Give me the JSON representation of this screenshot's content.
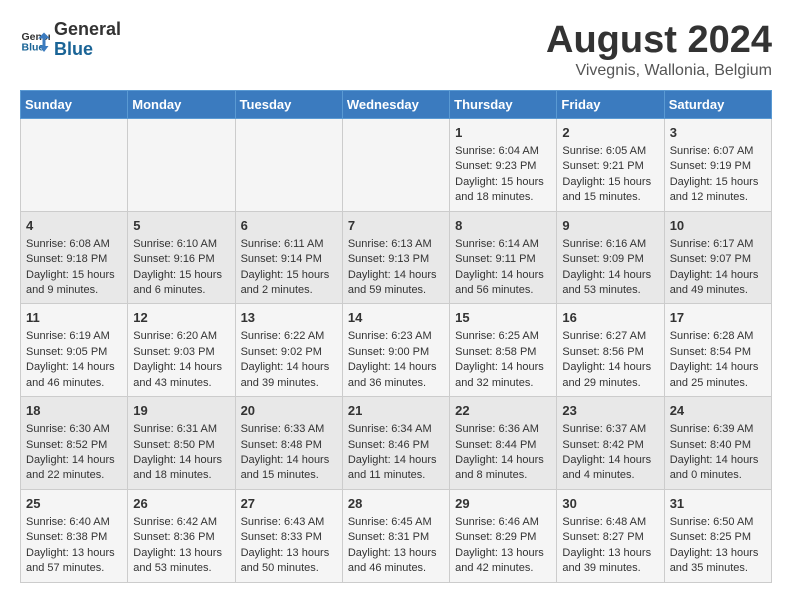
{
  "header": {
    "logo_line1": "General",
    "logo_line2": "Blue",
    "month": "August 2024",
    "location": "Vivegnis, Wallonia, Belgium"
  },
  "days_of_week": [
    "Sunday",
    "Monday",
    "Tuesday",
    "Wednesday",
    "Thursday",
    "Friday",
    "Saturday"
  ],
  "weeks": [
    [
      {
        "day": "",
        "content": ""
      },
      {
        "day": "",
        "content": ""
      },
      {
        "day": "",
        "content": ""
      },
      {
        "day": "",
        "content": ""
      },
      {
        "day": "1",
        "content": "Sunrise: 6:04 AM\nSunset: 9:23 PM\nDaylight: 15 hours\nand 18 minutes."
      },
      {
        "day": "2",
        "content": "Sunrise: 6:05 AM\nSunset: 9:21 PM\nDaylight: 15 hours\nand 15 minutes."
      },
      {
        "day": "3",
        "content": "Sunrise: 6:07 AM\nSunset: 9:19 PM\nDaylight: 15 hours\nand 12 minutes."
      }
    ],
    [
      {
        "day": "4",
        "content": "Sunrise: 6:08 AM\nSunset: 9:18 PM\nDaylight: 15 hours\nand 9 minutes."
      },
      {
        "day": "5",
        "content": "Sunrise: 6:10 AM\nSunset: 9:16 PM\nDaylight: 15 hours\nand 6 minutes."
      },
      {
        "day": "6",
        "content": "Sunrise: 6:11 AM\nSunset: 9:14 PM\nDaylight: 15 hours\nand 2 minutes."
      },
      {
        "day": "7",
        "content": "Sunrise: 6:13 AM\nSunset: 9:13 PM\nDaylight: 14 hours\nand 59 minutes."
      },
      {
        "day": "8",
        "content": "Sunrise: 6:14 AM\nSunset: 9:11 PM\nDaylight: 14 hours\nand 56 minutes."
      },
      {
        "day": "9",
        "content": "Sunrise: 6:16 AM\nSunset: 9:09 PM\nDaylight: 14 hours\nand 53 minutes."
      },
      {
        "day": "10",
        "content": "Sunrise: 6:17 AM\nSunset: 9:07 PM\nDaylight: 14 hours\nand 49 minutes."
      }
    ],
    [
      {
        "day": "11",
        "content": "Sunrise: 6:19 AM\nSunset: 9:05 PM\nDaylight: 14 hours\nand 46 minutes."
      },
      {
        "day": "12",
        "content": "Sunrise: 6:20 AM\nSunset: 9:03 PM\nDaylight: 14 hours\nand 43 minutes."
      },
      {
        "day": "13",
        "content": "Sunrise: 6:22 AM\nSunset: 9:02 PM\nDaylight: 14 hours\nand 39 minutes."
      },
      {
        "day": "14",
        "content": "Sunrise: 6:23 AM\nSunset: 9:00 PM\nDaylight: 14 hours\nand 36 minutes."
      },
      {
        "day": "15",
        "content": "Sunrise: 6:25 AM\nSunset: 8:58 PM\nDaylight: 14 hours\nand 32 minutes."
      },
      {
        "day": "16",
        "content": "Sunrise: 6:27 AM\nSunset: 8:56 PM\nDaylight: 14 hours\nand 29 minutes."
      },
      {
        "day": "17",
        "content": "Sunrise: 6:28 AM\nSunset: 8:54 PM\nDaylight: 14 hours\nand 25 minutes."
      }
    ],
    [
      {
        "day": "18",
        "content": "Sunrise: 6:30 AM\nSunset: 8:52 PM\nDaylight: 14 hours\nand 22 minutes."
      },
      {
        "day": "19",
        "content": "Sunrise: 6:31 AM\nSunset: 8:50 PM\nDaylight: 14 hours\nand 18 minutes."
      },
      {
        "day": "20",
        "content": "Sunrise: 6:33 AM\nSunset: 8:48 PM\nDaylight: 14 hours\nand 15 minutes."
      },
      {
        "day": "21",
        "content": "Sunrise: 6:34 AM\nSunset: 8:46 PM\nDaylight: 14 hours\nand 11 minutes."
      },
      {
        "day": "22",
        "content": "Sunrise: 6:36 AM\nSunset: 8:44 PM\nDaylight: 14 hours\nand 8 minutes."
      },
      {
        "day": "23",
        "content": "Sunrise: 6:37 AM\nSunset: 8:42 PM\nDaylight: 14 hours\nand 4 minutes."
      },
      {
        "day": "24",
        "content": "Sunrise: 6:39 AM\nSunset: 8:40 PM\nDaylight: 14 hours\nand 0 minutes."
      }
    ],
    [
      {
        "day": "25",
        "content": "Sunrise: 6:40 AM\nSunset: 8:38 PM\nDaylight: 13 hours\nand 57 minutes."
      },
      {
        "day": "26",
        "content": "Sunrise: 6:42 AM\nSunset: 8:36 PM\nDaylight: 13 hours\nand 53 minutes."
      },
      {
        "day": "27",
        "content": "Sunrise: 6:43 AM\nSunset: 8:33 PM\nDaylight: 13 hours\nand 50 minutes."
      },
      {
        "day": "28",
        "content": "Sunrise: 6:45 AM\nSunset: 8:31 PM\nDaylight: 13 hours\nand 46 minutes."
      },
      {
        "day": "29",
        "content": "Sunrise: 6:46 AM\nSunset: 8:29 PM\nDaylight: 13 hours\nand 42 minutes."
      },
      {
        "day": "30",
        "content": "Sunrise: 6:48 AM\nSunset: 8:27 PM\nDaylight: 13 hours\nand 39 minutes."
      },
      {
        "day": "31",
        "content": "Sunrise: 6:50 AM\nSunset: 8:25 PM\nDaylight: 13 hours\nand 35 minutes."
      }
    ]
  ]
}
